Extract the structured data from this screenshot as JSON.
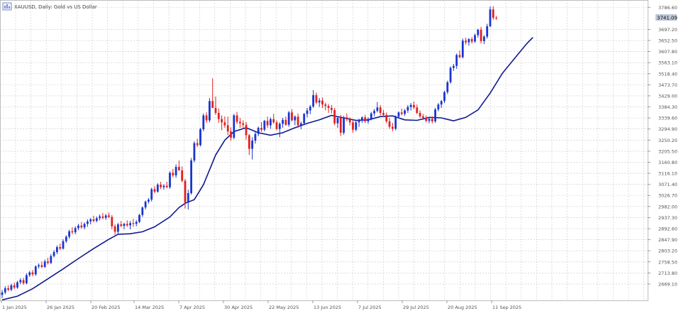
{
  "header": {
    "symbol_label": "XAUUSD, Daily: Gold vs US Dollar"
  },
  "price_tag": "3741.09",
  "colors": {
    "bull": "#1a35d0",
    "bear": "#e02020",
    "ma_line": "#101a8c",
    "ma_line_faded": "#8a8aa6",
    "grid": "#c8c8c8",
    "axis_text": "#555555",
    "price_tag_bg": "#c0c8d8"
  },
  "chart_data": {
    "type": "candlestick",
    "title": "XAUUSD, Daily: Gold vs US Dollar",
    "grid": true,
    "y_axis": {
      "position": "right",
      "range": [
        2603,
        3816
      ],
      "tick_labels": [
        "3786.60",
        "3697.20",
        "3652.50",
        "3607.80",
        "3563.10",
        "3518.40",
        "3473.70",
        "3429.00",
        "3384.30",
        "3339.60",
        "3294.90",
        "3250.20",
        "3205.50",
        "3160.80",
        "3116.10",
        "3071.40",
        "3026.70",
        "2982.00",
        "2937.30",
        "2892.60",
        "2847.90",
        "2803.20",
        "2758.50",
        "2713.80",
        "2669.10"
      ]
    },
    "x_axis": {
      "tick_labels": [
        "1 Jan 2025",
        "26 Jan 2025",
        "20 Feb 2025",
        "14 Mar 2025",
        "7 Apr 2025",
        "30 Apr 2025",
        "22 May 2025",
        "13 Jun 2025",
        "7 Jul 2025",
        "29 Jul 2025",
        "20 Aug 2025",
        "11 Sep 2025"
      ]
    },
    "series": [
      {
        "type": "ohlc",
        "values": [
          [
            2625,
            2645,
            2612,
            2635
          ],
          [
            2635,
            2660,
            2628,
            2652
          ],
          [
            2652,
            2664,
            2640,
            2646
          ],
          [
            2646,
            2670,
            2640,
            2664
          ],
          [
            2664,
            2675,
            2648,
            2655
          ],
          [
            2655,
            2682,
            2650,
            2676
          ],
          [
            2676,
            2692,
            2668,
            2685
          ],
          [
            2685,
            2694,
            2666,
            2672
          ],
          [
            2672,
            2712,
            2668,
            2705
          ],
          [
            2705,
            2722,
            2698,
            2716
          ],
          [
            2716,
            2726,
            2700,
            2708
          ],
          [
            2708,
            2745,
            2702,
            2740
          ],
          [
            2740,
            2752,
            2732,
            2745
          ],
          [
            2745,
            2760,
            2733,
            2738
          ],
          [
            2738,
            2768,
            2734,
            2760
          ],
          [
            2760,
            2775,
            2748,
            2754
          ],
          [
            2754,
            2790,
            2750,
            2782
          ],
          [
            2782,
            2806,
            2776,
            2798
          ],
          [
            2798,
            2825,
            2790,
            2818
          ],
          [
            2818,
            2832,
            2806,
            2812
          ],
          [
            2812,
            2850,
            2808,
            2842
          ],
          [
            2842,
            2866,
            2835,
            2860
          ],
          [
            2860,
            2888,
            2852,
            2882
          ],
          [
            2882,
            2898,
            2870,
            2878
          ],
          [
            2878,
            2902,
            2870,
            2895
          ],
          [
            2895,
            2912,
            2887,
            2905
          ],
          [
            2905,
            2920,
            2892,
            2898
          ],
          [
            2898,
            2918,
            2890,
            2912
          ],
          [
            2912,
            2930,
            2900,
            2922
          ],
          [
            2922,
            2936,
            2910,
            2930
          ],
          [
            2930,
            2945,
            2918,
            2924
          ],
          [
            2924,
            2942,
            2918,
            2935
          ],
          [
            2935,
            2950,
            2926,
            2942
          ],
          [
            2942,
            2956,
            2930,
            2936
          ],
          [
            2936,
            2952,
            2928,
            2946
          ],
          [
            2946,
            2958,
            2935,
            2940
          ],
          [
            2940,
            2948,
            2890,
            2902
          ],
          [
            2902,
            2910,
            2868,
            2880
          ],
          [
            2880,
            2916,
            2872,
            2910
          ],
          [
            2910,
            2924,
            2898,
            2904
          ],
          [
            2904,
            2916,
            2890,
            2912
          ],
          [
            2912,
            2926,
            2900,
            2906
          ],
          [
            2906,
            2924,
            2890,
            2915
          ],
          [
            2915,
            2932,
            2900,
            2912
          ],
          [
            2912,
            2928,
            2902,
            2920
          ],
          [
            2920,
            2952,
            2915,
            2948
          ],
          [
            2948,
            2982,
            2940,
            2978
          ],
          [
            2978,
            3006,
            2970,
            3002
          ],
          [
            3002,
            3016,
            2994,
            3010
          ],
          [
            3010,
            3058,
            3002,
            3052
          ],
          [
            3052,
            3064,
            3035,
            3042
          ],
          [
            3042,
            3076,
            3038,
            3070
          ],
          [
            3070,
            3082,
            3052,
            3060
          ],
          [
            3060,
            3072,
            3050,
            3066
          ],
          [
            3066,
            3082,
            3056,
            3060
          ],
          [
            3060,
            3124,
            3054,
            3118
          ],
          [
            3118,
            3134,
            3100,
            3108
          ],
          [
            3108,
            3152,
            3098,
            3142
          ],
          [
            3142,
            3168,
            3128,
            3128
          ],
          [
            3128,
            3144,
            3080,
            3086
          ],
          [
            3086,
            3094,
            2974,
            2998
          ],
          [
            2998,
            3050,
            2970,
            3036
          ],
          [
            3036,
            3178,
            3030,
            3168
          ],
          [
            3168,
            3245,
            3160,
            3238
          ],
          [
            3238,
            3256,
            3222,
            3230
          ],
          [
            3230,
            3300,
            3225,
            3294
          ],
          [
            3294,
            3358,
            3286,
            3350
          ],
          [
            3350,
            3362,
            3320,
            3330
          ],
          [
            3330,
            3420,
            3322,
            3408
          ],
          [
            3408,
            3500,
            3390,
            3380
          ],
          [
            3380,
            3426,
            3352,
            3360
          ],
          [
            3360,
            3378,
            3320,
            3335
          ],
          [
            3335,
            3350,
            3290,
            3322
          ],
          [
            3322,
            3346,
            3300,
            3310
          ],
          [
            3310,
            3345,
            3270,
            3285
          ],
          [
            3285,
            3302,
            3248,
            3260
          ],
          [
            3260,
            3356,
            3254,
            3350
          ],
          [
            3350,
            3364,
            3315,
            3324
          ],
          [
            3324,
            3340,
            3300,
            3318
          ],
          [
            3318,
            3330,
            3300,
            3312
          ],
          [
            3312,
            3324,
            3252,
            3270
          ],
          [
            3270,
            3275,
            3190,
            3215
          ],
          [
            3215,
            3262,
            3172,
            3248
          ],
          [
            3248,
            3282,
            3236,
            3275
          ],
          [
            3275,
            3305,
            3266,
            3300
          ],
          [
            3300,
            3322,
            3284,
            3292
          ],
          [
            3292,
            3332,
            3286,
            3328
          ],
          [
            3328,
            3345,
            3300,
            3310
          ],
          [
            3310,
            3342,
            3296,
            3335
          ],
          [
            3335,
            3356,
            3316,
            3322
          ],
          [
            3322,
            3330,
            3290,
            3295
          ],
          [
            3295,
            3322,
            3262,
            3316
          ],
          [
            3316,
            3340,
            3300,
            3332
          ],
          [
            3332,
            3345,
            3308,
            3312
          ],
          [
            3312,
            3368,
            3304,
            3362
          ],
          [
            3362,
            3375,
            3326,
            3330
          ],
          [
            3330,
            3350,
            3310,
            3345
          ],
          [
            3345,
            3358,
            3300,
            3310
          ],
          [
            3310,
            3325,
            3294,
            3318
          ],
          [
            3318,
            3360,
            3310,
            3356
          ],
          [
            3356,
            3380,
            3342,
            3370
          ],
          [
            3370,
            3392,
            3355,
            3386
          ],
          [
            3386,
            3452,
            3380,
            3432
          ],
          [
            3432,
            3442,
            3395,
            3402
          ],
          [
            3402,
            3420,
            3384,
            3410
          ],
          [
            3410,
            3422,
            3380,
            3394
          ],
          [
            3394,
            3402,
            3370,
            3388
          ],
          [
            3388,
            3396,
            3360,
            3380
          ],
          [
            3380,
            3392,
            3358,
            3372
          ],
          [
            3372,
            3380,
            3310,
            3318
          ],
          [
            3318,
            3345,
            3300,
            3340
          ],
          [
            3340,
            3352,
            3268,
            3280
          ],
          [
            3280,
            3348,
            3272,
            3342
          ],
          [
            3342,
            3358,
            3326,
            3334
          ],
          [
            3334,
            3342,
            3310,
            3322
          ],
          [
            3322,
            3330,
            3280,
            3292
          ],
          [
            3292,
            3328,
            3286,
            3322
          ],
          [
            3322,
            3336,
            3304,
            3330
          ],
          [
            3330,
            3346,
            3320,
            3342
          ],
          [
            3342,
            3352,
            3320,
            3326
          ],
          [
            3326,
            3342,
            3316,
            3336
          ],
          [
            3336,
            3364,
            3330,
            3358
          ],
          [
            3358,
            3376,
            3346,
            3368
          ],
          [
            3368,
            3404,
            3362,
            3382
          ],
          [
            3382,
            3392,
            3350,
            3360
          ],
          [
            3360,
            3372,
            3344,
            3352
          ],
          [
            3352,
            3362,
            3318,
            3326
          ],
          [
            3326,
            3340,
            3296,
            3304
          ],
          [
            3304,
            3320,
            3286,
            3296
          ],
          [
            3296,
            3350,
            3290,
            3345
          ],
          [
            3345,
            3366,
            3338,
            3362
          ],
          [
            3362,
            3378,
            3350,
            3356
          ],
          [
            3356,
            3376,
            3348,
            3370
          ],
          [
            3370,
            3392,
            3360,
            3384
          ],
          [
            3384,
            3400,
            3370,
            3392
          ],
          [
            3392,
            3406,
            3375,
            3382
          ],
          [
            3382,
            3394,
            3355,
            3360
          ],
          [
            3360,
            3370,
            3340,
            3346
          ],
          [
            3346,
            3356,
            3332,
            3340
          ],
          [
            3340,
            3350,
            3322,
            3328
          ],
          [
            3328,
            3342,
            3318,
            3336
          ],
          [
            3336,
            3346,
            3318,
            3326
          ],
          [
            3326,
            3380,
            3320,
            3374
          ],
          [
            3374,
            3400,
            3366,
            3394
          ],
          [
            3394,
            3412,
            3380,
            3408
          ],
          [
            3408,
            3450,
            3400,
            3444
          ],
          [
            3444,
            3490,
            3436,
            3484
          ],
          [
            3484,
            3548,
            3478,
            3542
          ],
          [
            3542,
            3558,
            3530,
            3550
          ],
          [
            3550,
            3600,
            3538,
            3594
          ],
          [
            3594,
            3612,
            3580,
            3585
          ],
          [
            3585,
            3660,
            3580,
            3652
          ],
          [
            3652,
            3664,
            3636,
            3645
          ],
          [
            3645,
            3662,
            3632,
            3658
          ],
          [
            3658,
            3666,
            3640,
            3648
          ],
          [
            3648,
            3680,
            3644,
            3674
          ],
          [
            3674,
            3700,
            3664,
            3696
          ],
          [
            3696,
            3708,
            3640,
            3650
          ],
          [
            3650,
            3674,
            3638,
            3668
          ],
          [
            3668,
            3720,
            3660,
            3710
          ],
          [
            3710,
            3790,
            3706,
            3778
          ],
          [
            3778,
            3791,
            3736,
            3744
          ],
          [
            3744,
            3752,
            3736,
            3741
          ]
        ]
      },
      {
        "type": "moving_average",
        "values": [
          [
            0,
            2605
          ],
          [
            5,
            2620
          ],
          [
            10,
            2650
          ],
          [
            15,
            2690
          ],
          [
            20,
            2730
          ],
          [
            25,
            2772
          ],
          [
            30,
            2812
          ],
          [
            35,
            2850
          ],
          [
            38,
            2870
          ],
          [
            42,
            2872
          ],
          [
            46,
            2880
          ],
          [
            50,
            2900
          ],
          [
            55,
            2940
          ],
          [
            58,
            2978
          ],
          [
            60,
            2995
          ],
          [
            63,
            3010
          ],
          [
            66,
            3070
          ],
          [
            70,
            3190
          ],
          [
            73,
            3250
          ],
          [
            76,
            3285
          ],
          [
            80,
            3300
          ],
          [
            84,
            3280
          ],
          [
            88,
            3270
          ],
          [
            92,
            3280
          ],
          [
            96,
            3300
          ],
          [
            100,
            3318
          ],
          [
            104,
            3332
          ],
          [
            108,
            3350
          ],
          [
            112,
            3340
          ],
          [
            116,
            3330
          ],
          [
            120,
            3332
          ],
          [
            124,
            3345
          ],
          [
            128,
            3348
          ],
          [
            132,
            3332
          ],
          [
            136,
            3330
          ],
          [
            140,
            3342
          ],
          [
            144,
            3340
          ],
          [
            148,
            3328
          ],
          [
            152,
            3342
          ],
          [
            156,
            3372
          ],
          [
            160,
            3440
          ],
          [
            164,
            3520
          ],
          [
            168,
            3580
          ],
          [
            172,
            3640
          ],
          [
            174,
            3665
          ]
        ]
      }
    ]
  }
}
